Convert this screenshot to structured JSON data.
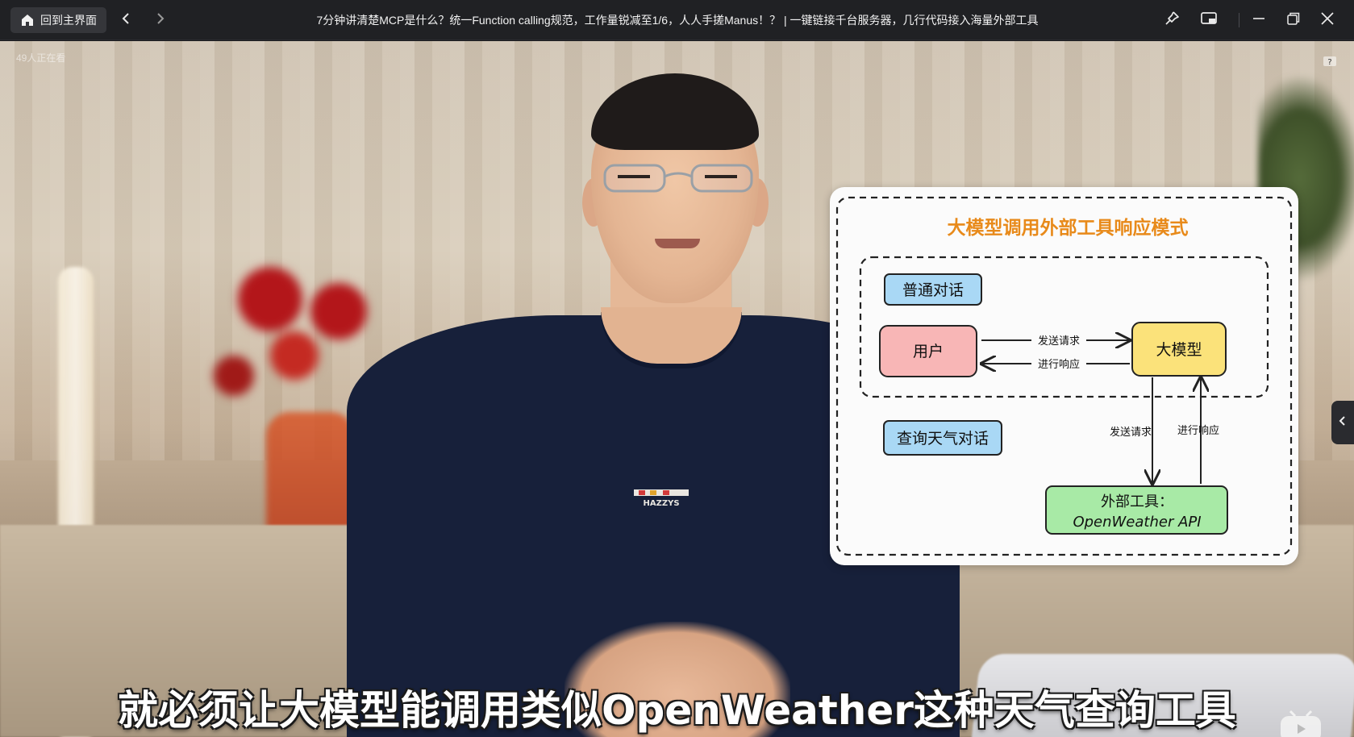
{
  "titlebar": {
    "home_label": "回到主界面",
    "title": "7分钟讲清楚MCP是什么？统一Function calling规范，工作量锐减至1/6，人人手搓Manus！？ | 一键链接千台服务器，几行代码接入海量外部工具",
    "icons": [
      "home-icon",
      "back-icon",
      "forward-icon",
      "pin-icon",
      "picture-in-picture-icon",
      "minimize-icon",
      "restore-icon",
      "close-icon"
    ]
  },
  "video": {
    "viewers_text": "49人正在看",
    "subtitle": "就必须让大模型能调用类似OpenWeather这种天气查询工具",
    "shirt_logo": "HAZZYS"
  },
  "diagram": {
    "title": "大模型调用外部工具响应模式",
    "section_normal": "普通对话",
    "section_weather": "查询天气对话",
    "node_user": "用户",
    "node_llm": "大模型",
    "node_tool_line1": "外部工具：",
    "node_tool_line2": "OpenWeather API",
    "edge_send": "发送请求",
    "edge_respond": "进行响应",
    "edge_send_down": "发送请求",
    "edge_respond_up": "进行响应",
    "colors": {
      "title": "#e88a1a",
      "user_fill": "#f8b6b6",
      "llm_fill": "#fbe27a",
      "tool_fill": "#a8eaa6",
      "label_fill": "#a9d8f5"
    }
  }
}
